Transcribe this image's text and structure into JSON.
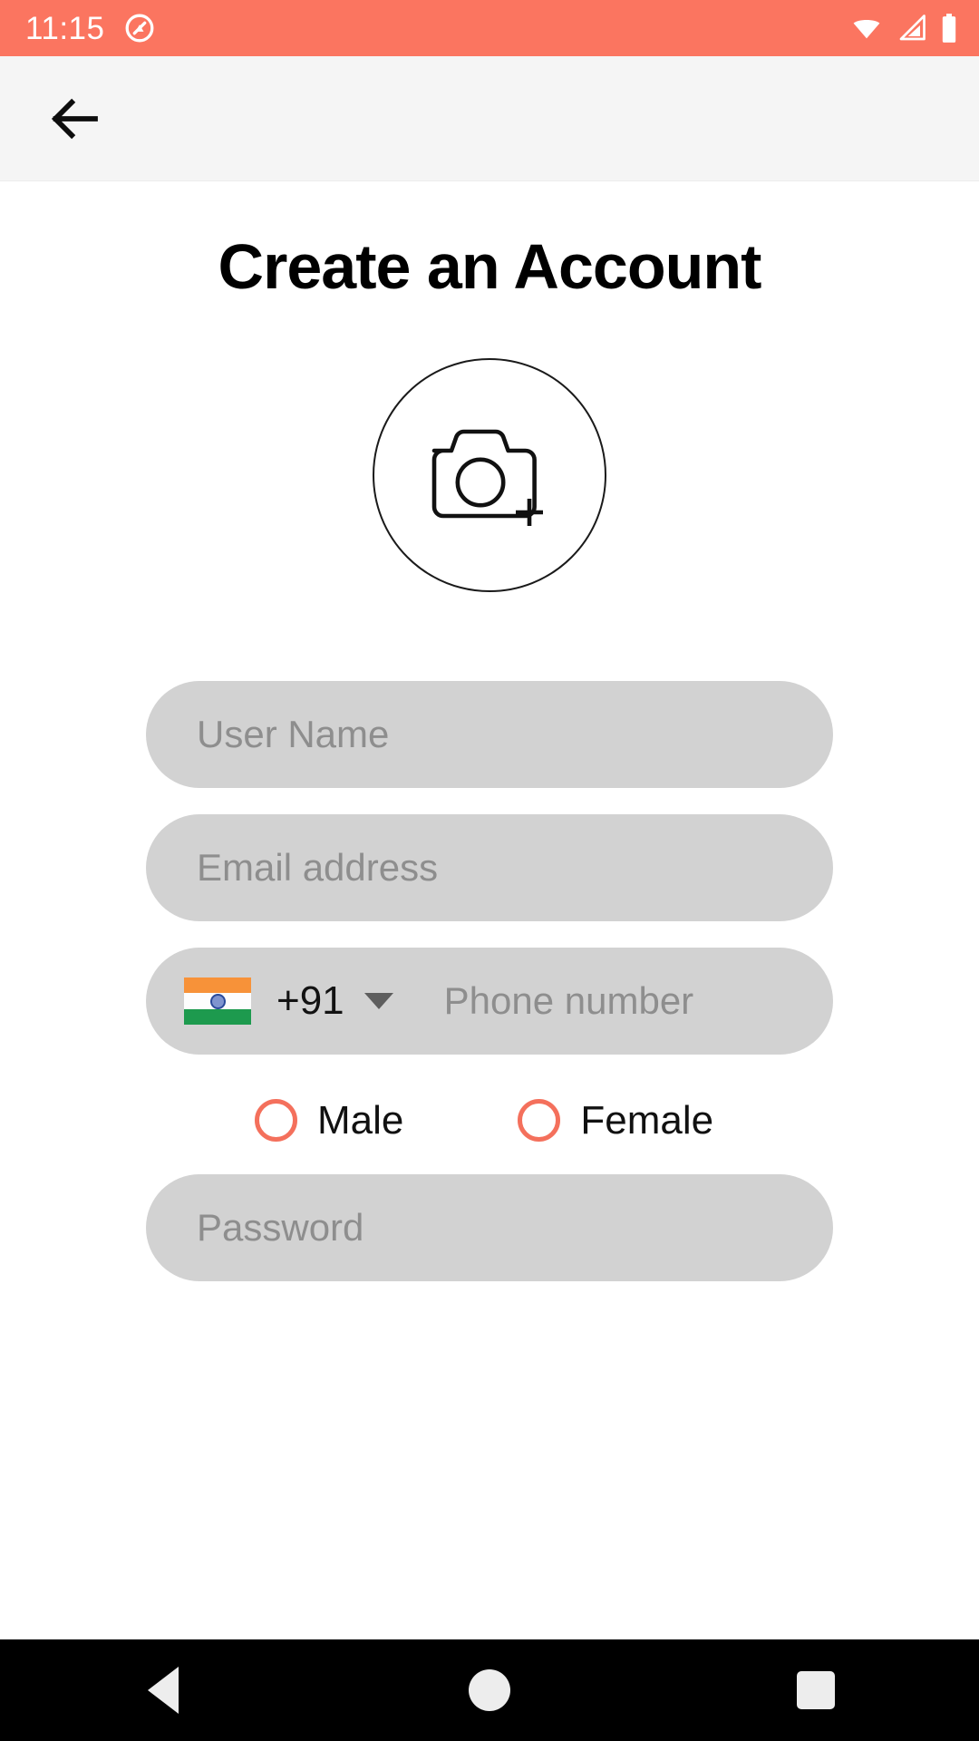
{
  "status_bar": {
    "time": "11:15",
    "background_color": "#fb7560",
    "left_icons": [
      "do-not-disturb-icon"
    ],
    "right_icons": [
      "wifi-icon",
      "cellular-signal-icon",
      "battery-icon"
    ]
  },
  "app_bar": {
    "back_icon": "arrow-left-icon",
    "background_color": "#f5f5f5"
  },
  "main": {
    "title": "Create an Account",
    "avatar": {
      "icon": "camera-add-icon",
      "hint": "add profile photo"
    },
    "fields": [
      {
        "name": "user-name",
        "placeholder": "User Name",
        "value": ""
      },
      {
        "name": "email-address",
        "placeholder": "Email address",
        "value": ""
      }
    ],
    "phone": {
      "flag": "india-flag-icon",
      "dial_code": "+91",
      "dropdown_icon": "caret-down-icon",
      "placeholder": "Phone number",
      "value": ""
    },
    "gender": {
      "options": [
        {
          "label": "Male",
          "selected": false
        },
        {
          "label": "Female",
          "selected": false
        }
      ],
      "accent_color": "#f4705c"
    },
    "password": {
      "placeholder": "Password",
      "value": ""
    }
  },
  "nav_bar": {
    "background_color": "#000000",
    "buttons": [
      "back-triangle-icon",
      "home-circle-icon",
      "recents-square-icon"
    ]
  },
  "colors": {
    "accent": "#fb7560",
    "field_background": "#d2d2d2",
    "placeholder_text": "#8e8e8e"
  }
}
